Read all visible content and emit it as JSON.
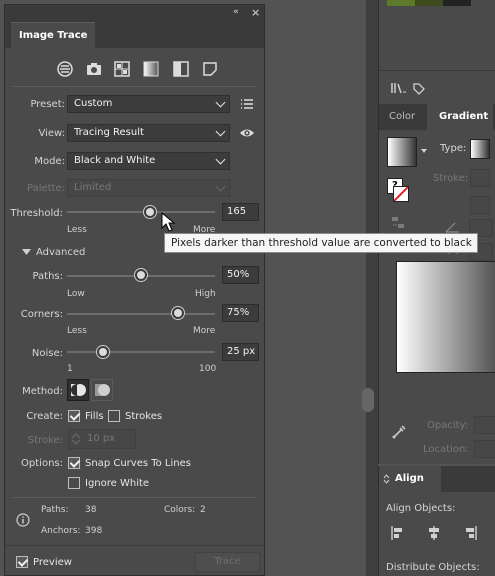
{
  "image_trace": {
    "tab_title": "Image Trace",
    "window_controls": {
      "collapse": "«",
      "close": "×"
    },
    "preset_icons": [
      "auto-color-icon",
      "camera-icon",
      "grid-icon",
      "gradient-square-icon",
      "half-square-icon",
      "shape-outline-icon"
    ],
    "preset": {
      "label": "Preset:",
      "value": "Custom"
    },
    "view": {
      "label": "View:",
      "value": "Tracing Result"
    },
    "mode": {
      "label": "Mode:",
      "value": "Black and White"
    },
    "palette": {
      "label": "Palette:",
      "value": "Limited"
    },
    "threshold": {
      "label": "Threshold:",
      "value": "165",
      "min_label": "Less",
      "max_label": "More",
      "level": 0.56
    },
    "advanced": {
      "label": "Advanced"
    },
    "paths": {
      "label": "Paths:",
      "value": "50%",
      "min_label": "Low",
      "max_label": "High",
      "level": 0.5
    },
    "corners": {
      "label": "Corners:",
      "value": "75%",
      "min_label": "Less",
      "max_label": "More",
      "level": 0.75
    },
    "noise": {
      "label": "Noise:",
      "value": "25 px",
      "min_label": "1",
      "max_label": "100",
      "level": 0.24
    },
    "method": {
      "label": "Method:"
    },
    "create": {
      "label": "Create:",
      "fills": "Fills",
      "fills_checked": true,
      "strokes": "Strokes",
      "strokes_checked": false
    },
    "stroke": {
      "label": "Stroke:",
      "value": "10 px"
    },
    "options": {
      "label": "Options:",
      "snap": "Snap Curves To Lines",
      "snap_checked": true,
      "ignore_white": "Ignore White",
      "ignore_white_checked": false
    },
    "stats": {
      "paths_label": "Paths:",
      "paths_value": "38",
      "colors_label": "Colors:",
      "colors_value": "2",
      "anchors_label": "Anchors:",
      "anchors_value": "398"
    },
    "preview": {
      "label": "Preview",
      "checked": true
    },
    "trace_button": "Trace"
  },
  "tooltip": "Pixels darker than threshold value are converted to black",
  "gradient_panel": {
    "tabs": [
      "Color",
      "Gradient"
    ],
    "type_label": "Type:",
    "stroke_label": "Stroke:",
    "opacity_label": "Opacity:",
    "location_label": "Location:"
  },
  "align_panel": {
    "title": "Align",
    "align_objects": "Align Objects:",
    "distribute_objects": "Distribute Objects:"
  },
  "colors": {
    "panel_bg": "#4a4a4a",
    "app_bg": "#535353",
    "tooltip_bg": "#f6f6f6"
  }
}
